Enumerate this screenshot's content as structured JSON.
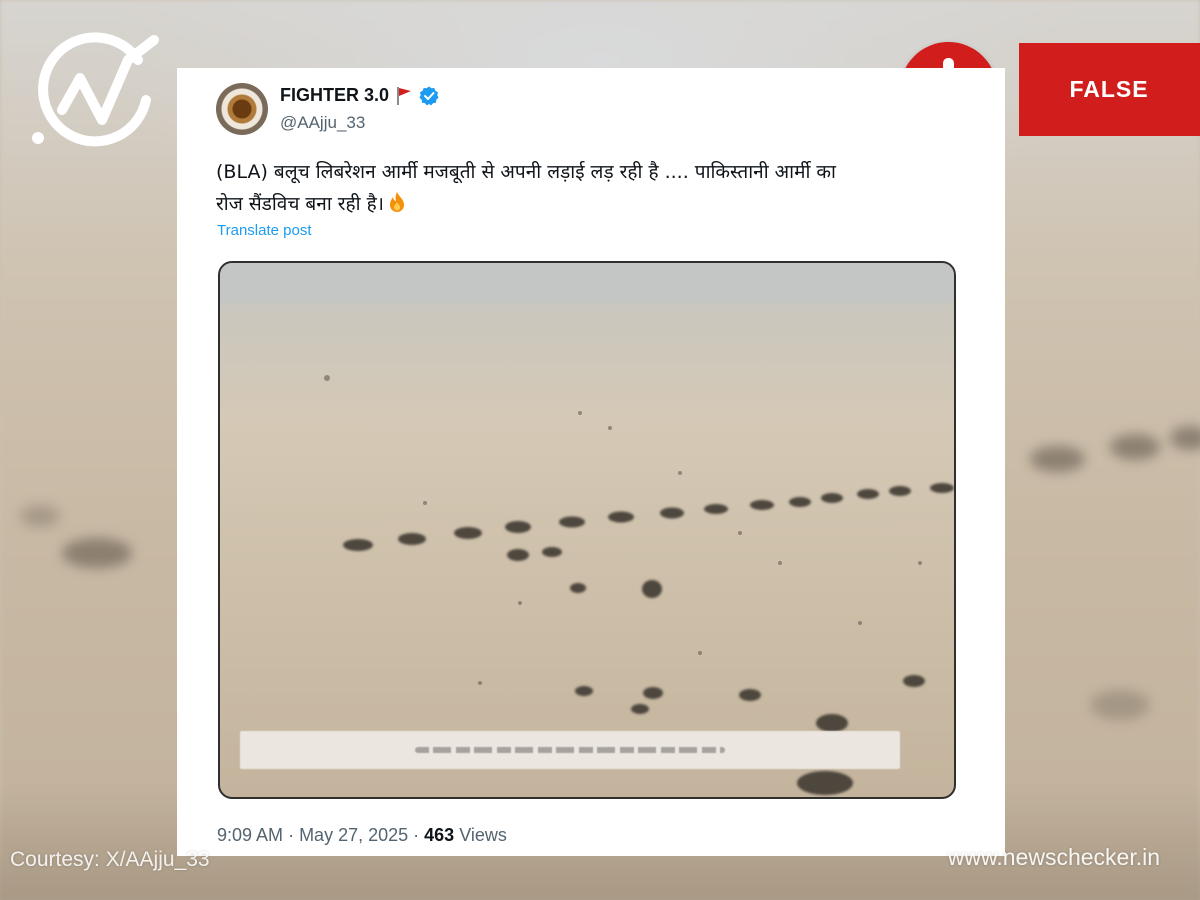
{
  "tweet": {
    "display_name": "FIGHTER 3.0",
    "handle": "@AAjju_33",
    "text_line1": "(BLA) बलूच लिबरेशन आर्मी मजबूती से अपनी लड़ाई लड़ रही है .... पाकिस्तानी आर्मी का",
    "text_line2": "रोज सैंडविच बना रही है।",
    "translate_label": "Translate post",
    "time": "9:09 AM",
    "date": "May 27, 2025",
    "views_count": "463",
    "views_label": "Views",
    "icons": [
      "avatar",
      "flag-icon",
      "verified-icon",
      "fire-icon"
    ]
  },
  "overlay": {
    "verdict": "FALSE",
    "verdict_color": "#d11d1c",
    "courtesy": "Courtesy: X/AAjju_33",
    "site": "www.newschecker.in",
    "logo_icon": "newschecker-logo"
  }
}
